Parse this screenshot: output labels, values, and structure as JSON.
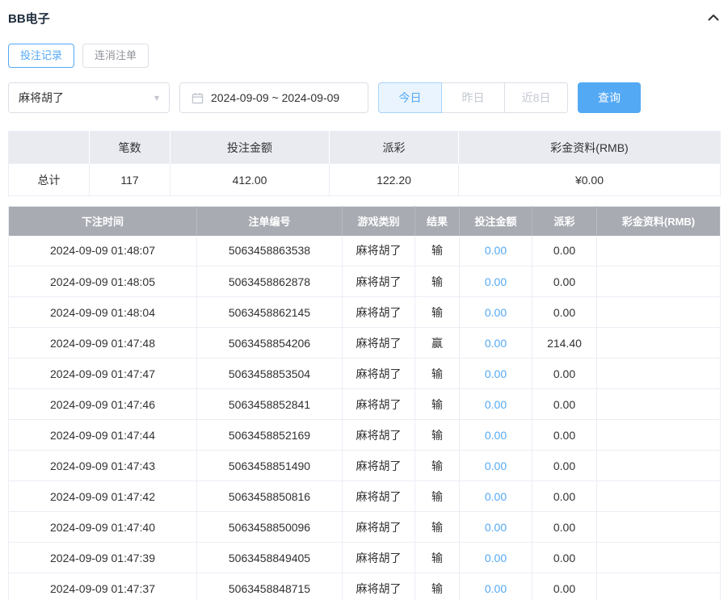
{
  "header": {
    "title": "BB电子"
  },
  "tabs": [
    {
      "label": "投注记录",
      "active": true
    },
    {
      "label": "连消注单",
      "active": false
    }
  ],
  "filters": {
    "game_select_value": "麻将胡了",
    "date_range": "2024-09-09 ~ 2024-09-09",
    "quick_buttons": [
      {
        "label": "今日",
        "active": true
      },
      {
        "label": "昨日",
        "active": false
      },
      {
        "label": "近8日",
        "active": false
      }
    ],
    "search_label": "查询"
  },
  "summary": {
    "headers": [
      "",
      "笔数",
      "投注金额",
      "派彩",
      "彩金资料(RMB)"
    ],
    "row_label": "总计",
    "count": "117",
    "bet_amount": "412.00",
    "payout": "122.20",
    "jackpot": "¥0.00"
  },
  "table": {
    "headers": [
      "下注时间",
      "注单编号",
      "游戏类别",
      "结果",
      "投注金额",
      "派彩",
      "彩金资料(RMB)"
    ],
    "rows": [
      {
        "time": "2024-09-09 01:48:07",
        "order": "5063458863538",
        "game": "麻将胡了",
        "result": "输",
        "bet": "0.00",
        "payout": "0.00",
        "jackpot": ""
      },
      {
        "time": "2024-09-09 01:48:05",
        "order": "5063458862878",
        "game": "麻将胡了",
        "result": "输",
        "bet": "0.00",
        "payout": "0.00",
        "jackpot": ""
      },
      {
        "time": "2024-09-09 01:48:04",
        "order": "5063458862145",
        "game": "麻将胡了",
        "result": "输",
        "bet": "0.00",
        "payout": "0.00",
        "jackpot": ""
      },
      {
        "time": "2024-09-09 01:47:48",
        "order": "5063458854206",
        "game": "麻将胡了",
        "result": "赢",
        "bet": "0.00",
        "payout": "214.40",
        "jackpot": ""
      },
      {
        "time": "2024-09-09 01:47:47",
        "order": "5063458853504",
        "game": "麻将胡了",
        "result": "输",
        "bet": "0.00",
        "payout": "0.00",
        "jackpot": ""
      },
      {
        "time": "2024-09-09 01:47:46",
        "order": "5063458852841",
        "game": "麻将胡了",
        "result": "输",
        "bet": "0.00",
        "payout": "0.00",
        "jackpot": ""
      },
      {
        "time": "2024-09-09 01:47:44",
        "order": "5063458852169",
        "game": "麻将胡了",
        "result": "输",
        "bet": "0.00",
        "payout": "0.00",
        "jackpot": ""
      },
      {
        "time": "2024-09-09 01:47:43",
        "order": "5063458851490",
        "game": "麻将胡了",
        "result": "输",
        "bet": "0.00",
        "payout": "0.00",
        "jackpot": ""
      },
      {
        "time": "2024-09-09 01:47:42",
        "order": "5063458850816",
        "game": "麻将胡了",
        "result": "输",
        "bet": "0.00",
        "payout": "0.00",
        "jackpot": ""
      },
      {
        "time": "2024-09-09 01:47:40",
        "order": "5063458850096",
        "game": "麻将胡了",
        "result": "输",
        "bet": "0.00",
        "payout": "0.00",
        "jackpot": ""
      },
      {
        "time": "2024-09-09 01:47:39",
        "order": "5063458849405",
        "game": "麻将胡了",
        "result": "输",
        "bet": "0.00",
        "payout": "0.00",
        "jackpot": ""
      },
      {
        "time": "2024-09-09 01:47:37",
        "order": "5063458848715",
        "game": "麻将胡了",
        "result": "输",
        "bet": "0.00",
        "payout": "0.00",
        "jackpot": ""
      }
    ]
  },
  "colors": {
    "accent": "#54a9f5",
    "table_header_bg": "#a8abb2",
    "summary_header_bg": "#e9ebf0"
  }
}
